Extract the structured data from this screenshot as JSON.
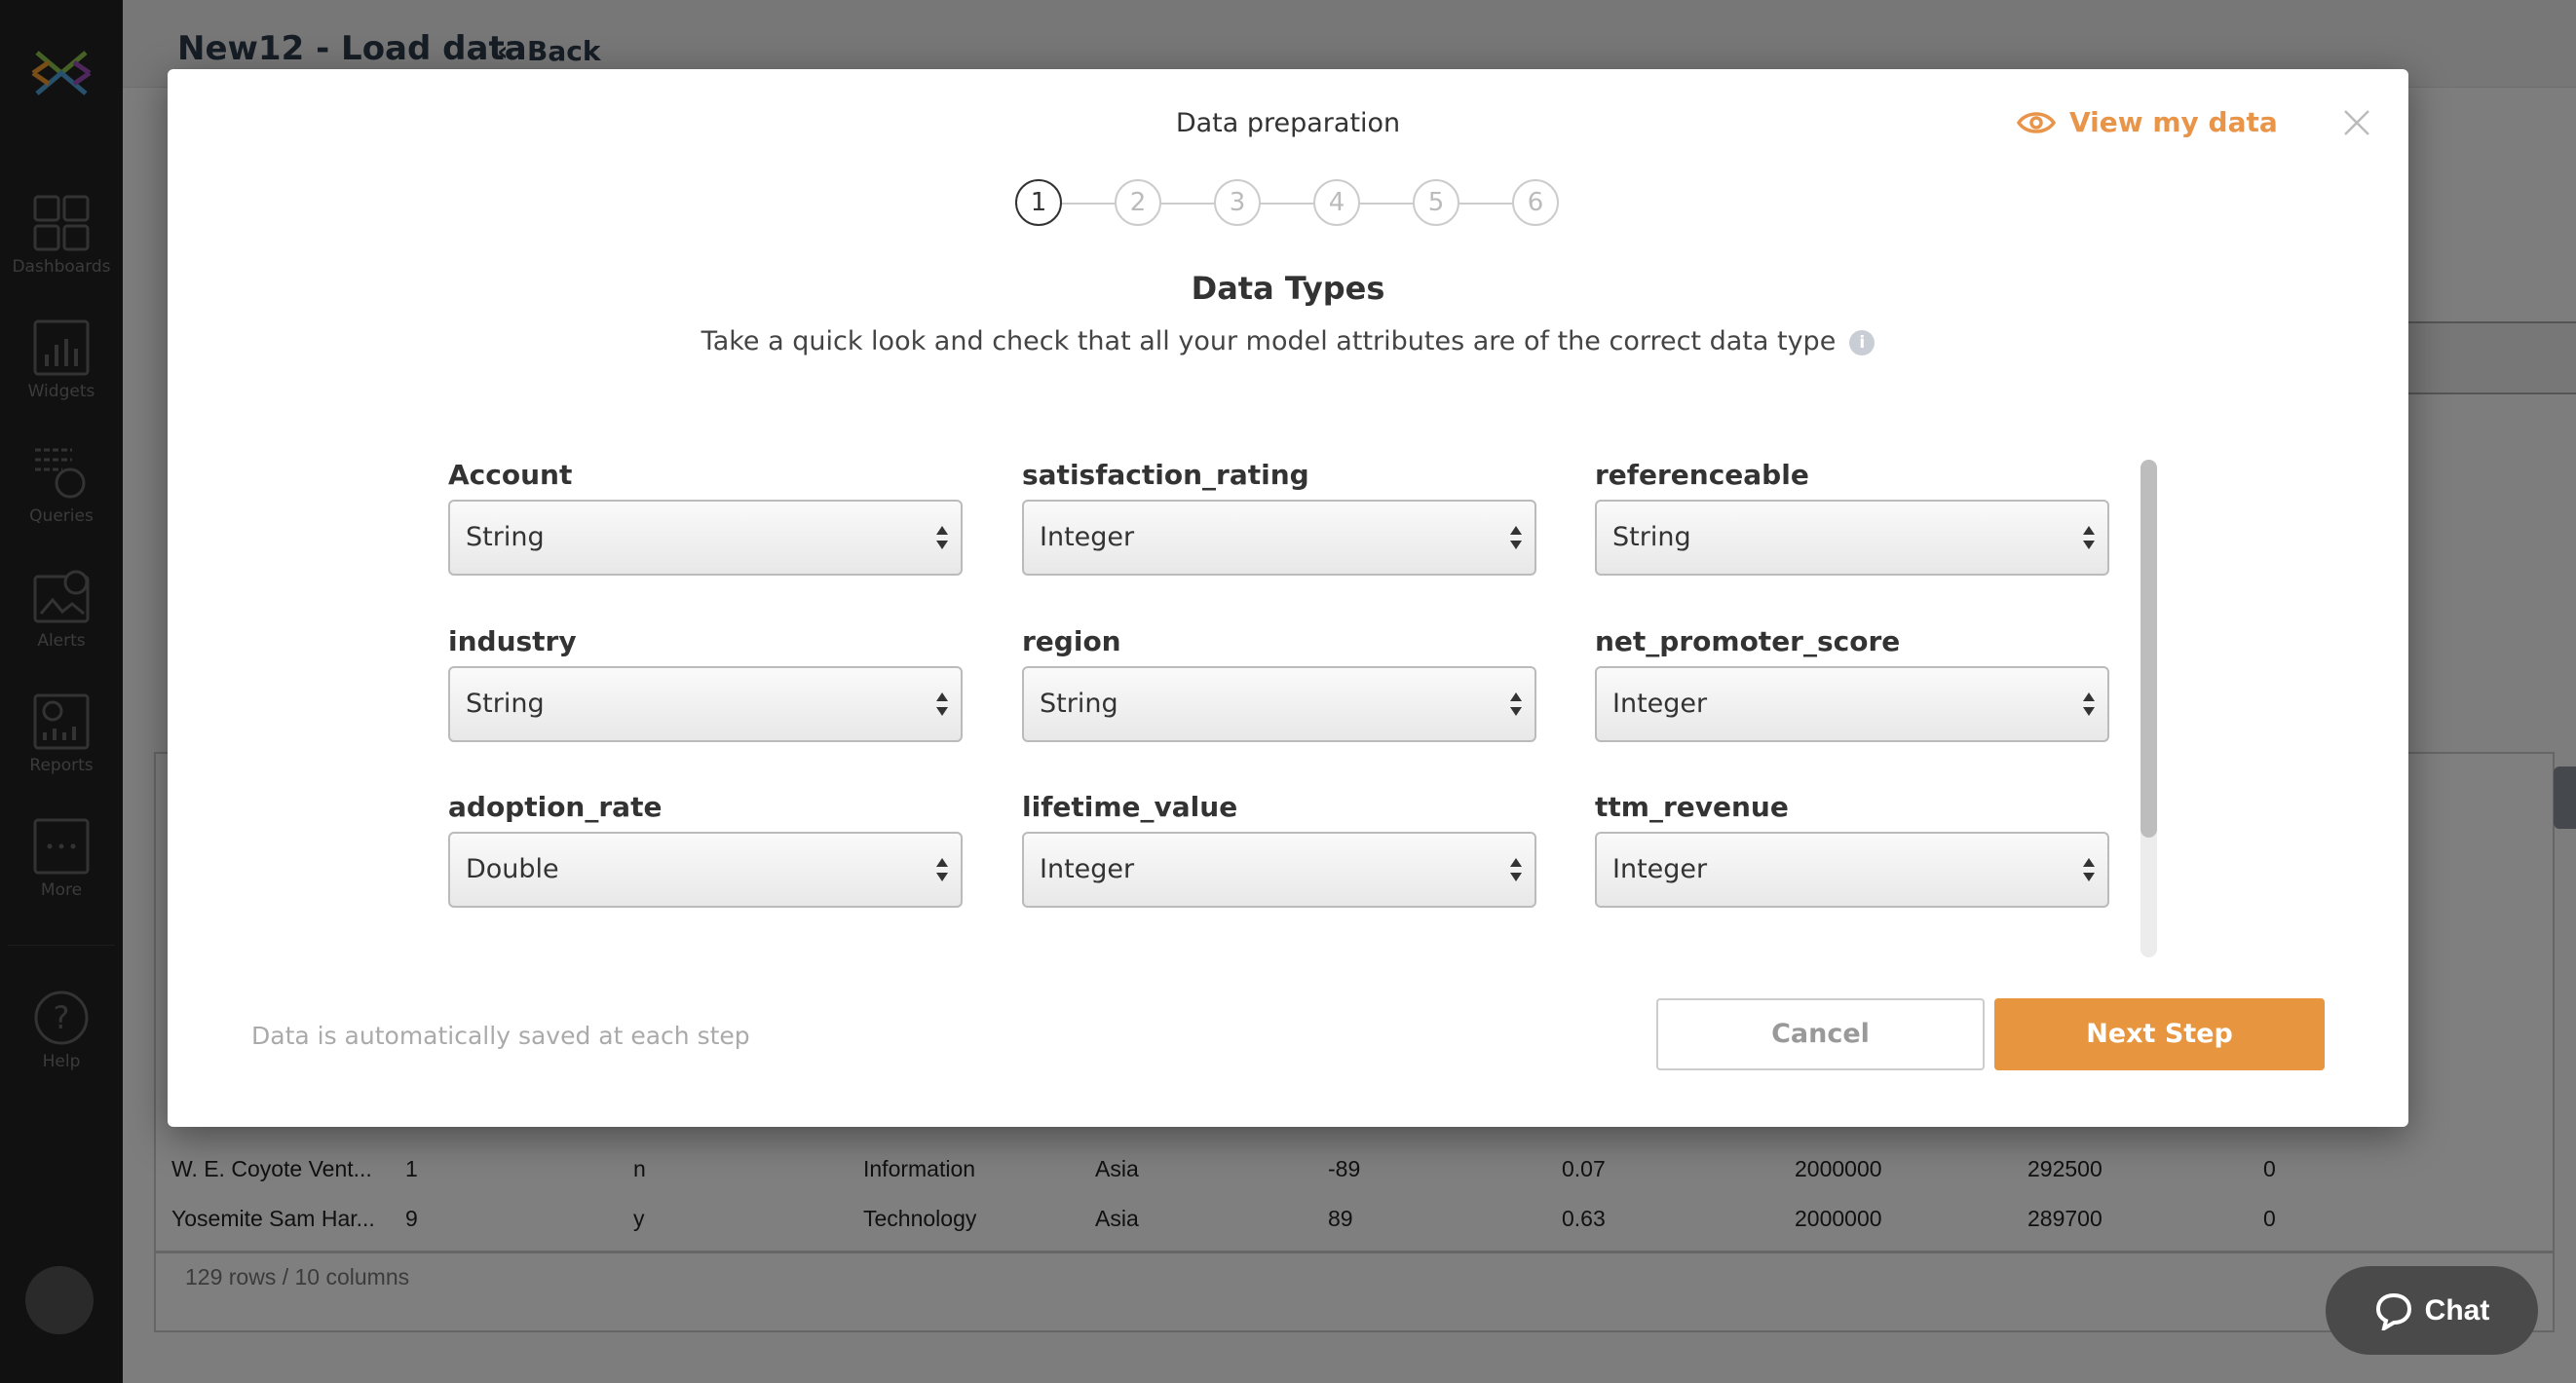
{
  "sidebar": {
    "items": [
      {
        "label": "Dashboards",
        "icon": "dashboards-icon"
      },
      {
        "label": "Widgets",
        "icon": "widgets-icon"
      },
      {
        "label": "Queries",
        "icon": "queries-icon"
      },
      {
        "label": "Alerts",
        "icon": "alerts-icon"
      },
      {
        "label": "Reports",
        "icon": "reports-icon"
      },
      {
        "label": "More",
        "icon": "more-icon"
      }
    ],
    "help": "Help"
  },
  "header": {
    "title": "New12 - Load data",
    "back": "Back"
  },
  "table": {
    "rows": [
      [
        "W. E. Coyote Vent...",
        "1",
        "n",
        "Information",
        "Asia",
        "-89",
        "0.07",
        "2000000",
        "292500",
        "0"
      ],
      [
        "Yosemite Sam Har...",
        "9",
        "y",
        "Technology",
        "Asia",
        "89",
        "0.63",
        "2000000",
        "289700",
        "0"
      ]
    ],
    "footer": "129 rows / 10 columns"
  },
  "chat": {
    "label": "Chat"
  },
  "modal": {
    "title": "Data preparation",
    "view_data": "View my data",
    "steps": [
      "1",
      "2",
      "3",
      "4",
      "5",
      "6"
    ],
    "active_step": 1,
    "heading": "Data Types",
    "subtitle": "Take a quick look and check that all your model attributes are of the correct data type",
    "fields": [
      {
        "label": "Account",
        "value": "String"
      },
      {
        "label": "satisfaction_rating",
        "value": "Integer"
      },
      {
        "label": "referenceable",
        "value": "String"
      },
      {
        "label": "industry",
        "value": "String"
      },
      {
        "label": "region",
        "value": "String"
      },
      {
        "label": "net_promoter_score",
        "value": "Integer"
      },
      {
        "label": "adoption_rate",
        "value": "Double"
      },
      {
        "label": "lifetime_value",
        "value": "Integer"
      },
      {
        "label": "ttm_revenue",
        "value": "Integer"
      }
    ],
    "note": "Data is automatically saved at each step",
    "cancel": "Cancel",
    "next": "Next Step"
  },
  "colors": {
    "accent": "#e8953f",
    "sidebar": "#232323"
  }
}
